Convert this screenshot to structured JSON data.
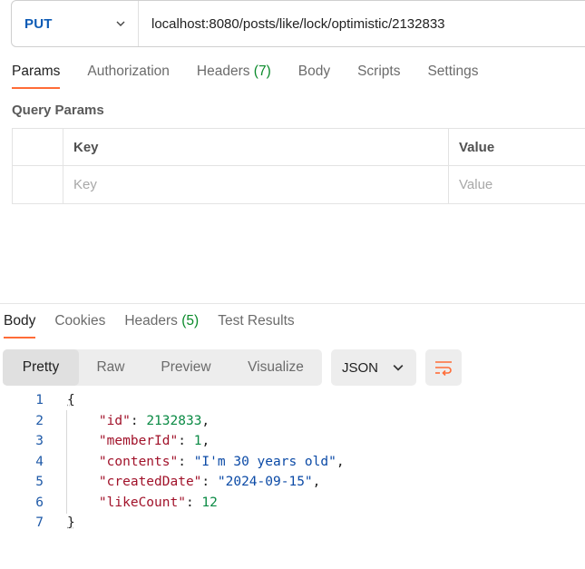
{
  "request": {
    "method": "PUT",
    "url": "localhost:8080/posts/like/lock/optimistic/2132833"
  },
  "request_tabs": [
    {
      "label": "Params",
      "count": "",
      "active": true
    },
    {
      "label": "Authorization",
      "count": ""
    },
    {
      "label": "Headers",
      "count": "(7)"
    },
    {
      "label": "Body",
      "count": ""
    },
    {
      "label": "Scripts",
      "count": ""
    },
    {
      "label": "Settings",
      "count": ""
    }
  ],
  "query_params": {
    "title": "Query Params",
    "headers": {
      "key": "Key",
      "value": "Value"
    },
    "placeholders": {
      "key": "Key",
      "value": "Value"
    }
  },
  "response_tabs": [
    {
      "label": "Body",
      "count": "",
      "active": true
    },
    {
      "label": "Cookies",
      "count": ""
    },
    {
      "label": "Headers",
      "count": "(5)"
    },
    {
      "label": "Test Results",
      "count": ""
    }
  ],
  "view_modes": [
    "Pretty",
    "Raw",
    "Preview",
    "Visualize"
  ],
  "active_view_mode": "Pretty",
  "format": "JSON",
  "response_body": {
    "line_numbers": [
      "1",
      "2",
      "3",
      "4",
      "5",
      "6",
      "7"
    ],
    "open_brace": "{",
    "close_brace": "}",
    "fields": [
      {
        "key": "\"id\"",
        "value": "2132833",
        "kind": "number",
        "comma": ","
      },
      {
        "key": "\"memberId\"",
        "value": "1",
        "kind": "number",
        "comma": ","
      },
      {
        "key": "\"contents\"",
        "value": "\"I'm 30 years old\"",
        "kind": "string",
        "comma": ","
      },
      {
        "key": "\"createdDate\"",
        "value": "\"2024-09-15\"",
        "kind": "string",
        "comma": ","
      },
      {
        "key": "\"likeCount\"",
        "value": "12",
        "kind": "number",
        "comma": ""
      }
    ]
  },
  "colors": {
    "accent": "#ff6c37",
    "method": "#0d5bb5",
    "count": "#0a8a2a",
    "json_key": "#a1122a",
    "json_number": "#0a8a44",
    "json_string": "#0b4aa6"
  }
}
